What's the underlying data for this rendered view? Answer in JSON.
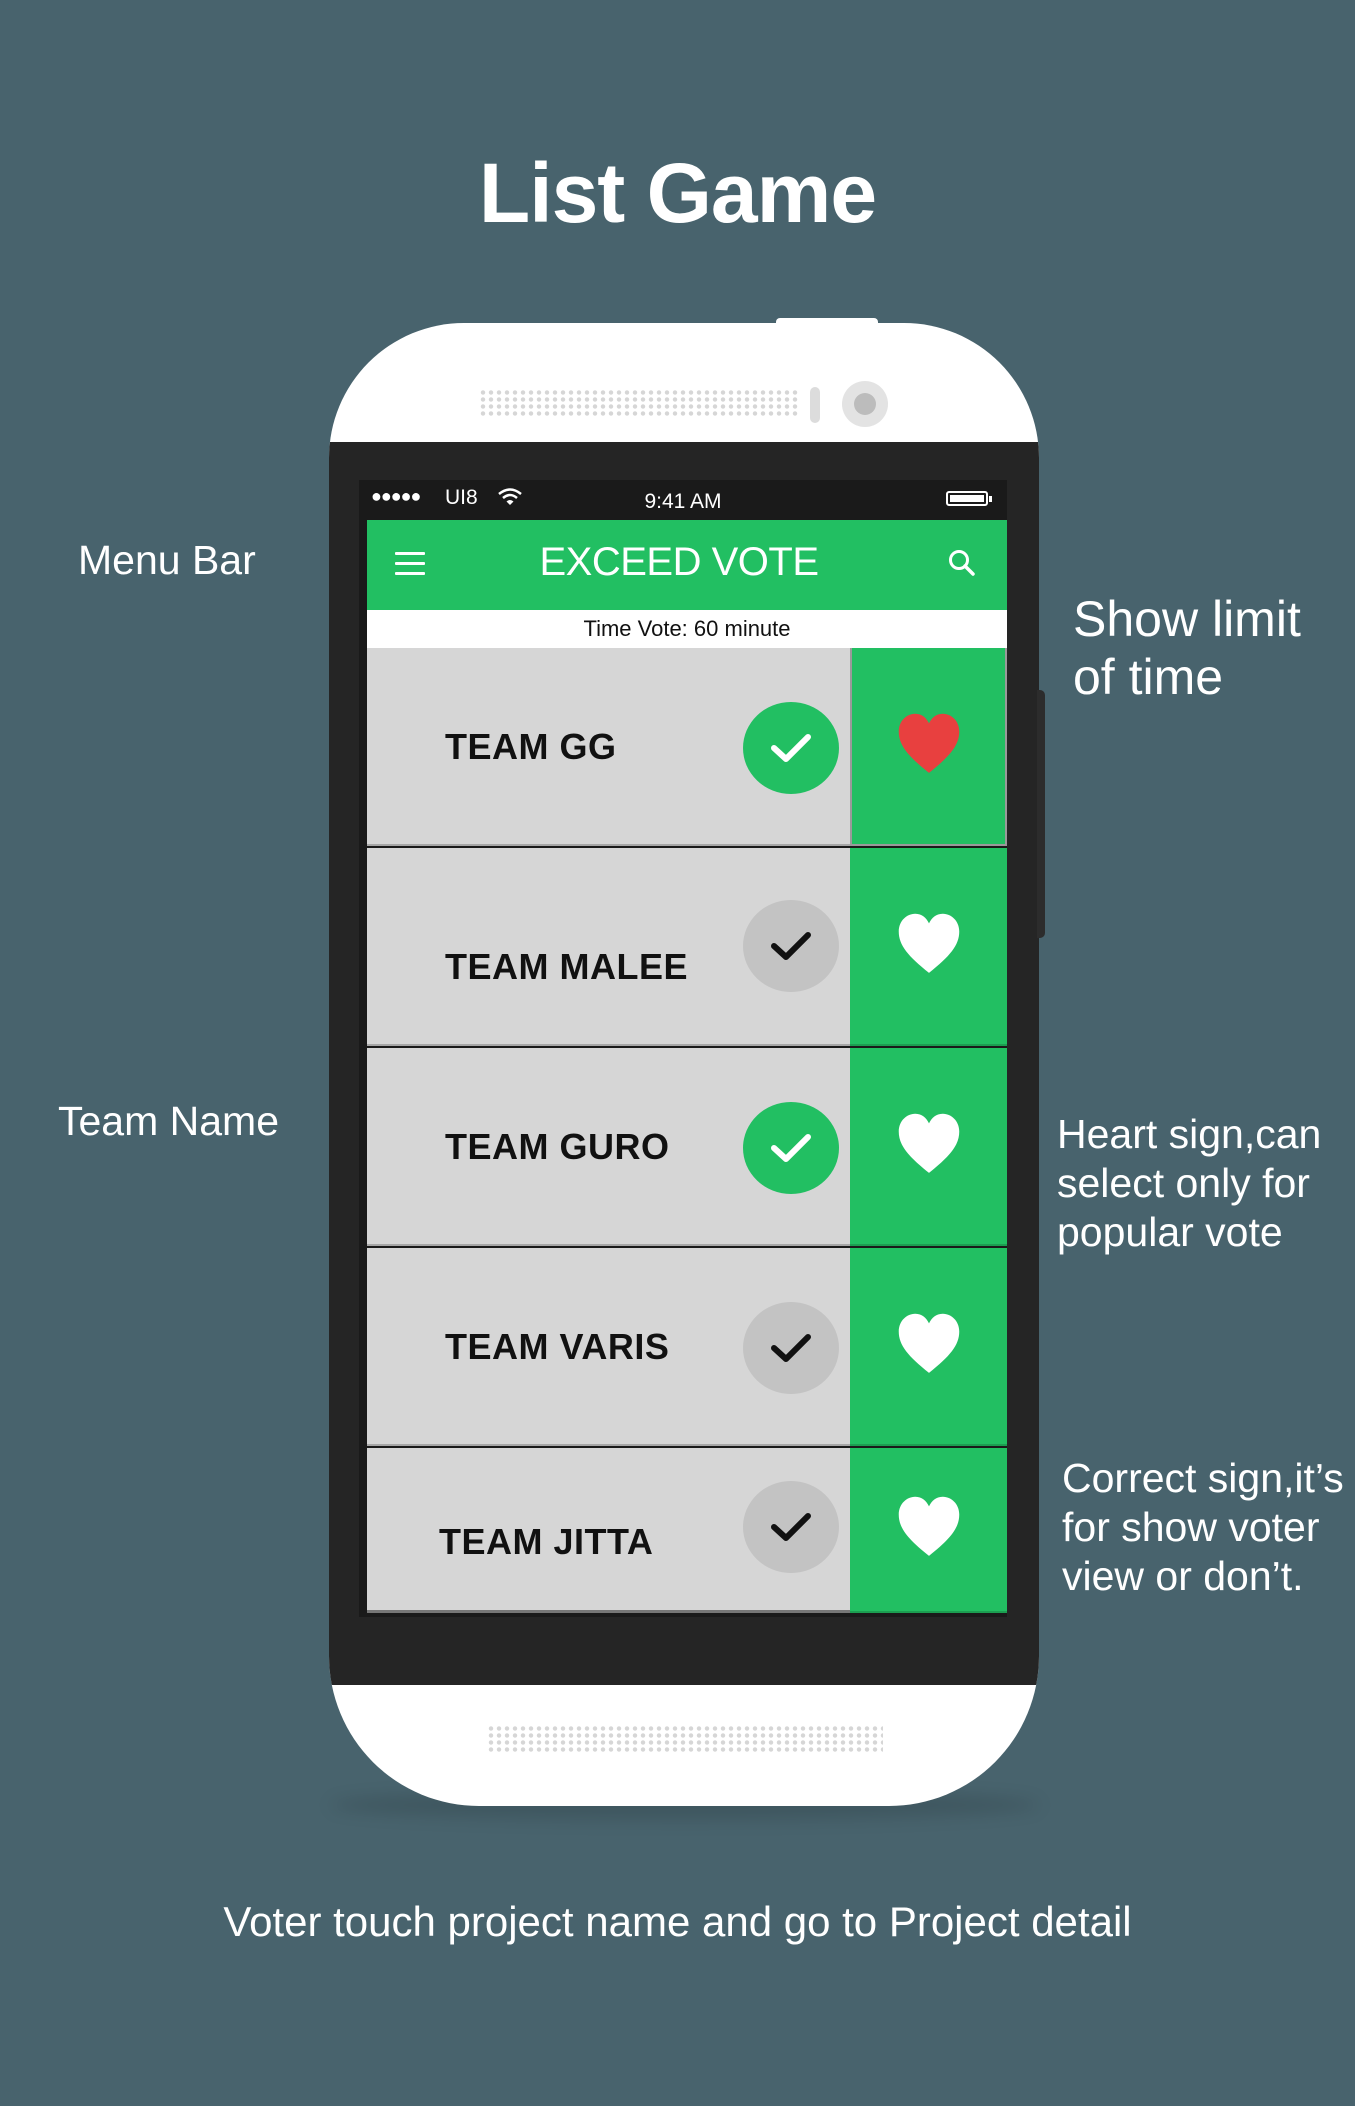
{
  "page": {
    "title": "List Game",
    "caption": "Voter touch project name and go to Project detail"
  },
  "annotations": {
    "menu_bar": "Menu Bar",
    "team_name": "Team Name",
    "time_limit": "Show limit\nof time",
    "heart": "Heart sign,can\nselect only for\npopular vote",
    "correct": "Correct sign,it’s\nfor show voter\nview or don’t."
  },
  "status_bar": {
    "signal": "●●●●●",
    "carrier": "UI8",
    "time": "9:41 AM"
  },
  "app": {
    "title": "EXCEED VOTE",
    "time_vote": "Time Vote: 60 minute"
  },
  "teams": [
    {
      "name": "TEAM GG",
      "checked": true,
      "liked": true
    },
    {
      "name": "TEAM MALEE",
      "checked": false,
      "liked": false
    },
    {
      "name": "TEAM GURO",
      "checked": true,
      "liked": false
    },
    {
      "name": "TEAM VARIS",
      "checked": false,
      "liked": false
    },
    {
      "name": "TEAM JITTA",
      "checked": false,
      "liked": false
    }
  ],
  "icons": {
    "menu": "menu-icon",
    "search": "search-icon",
    "check": "check-icon",
    "heart": "heart-icon",
    "wifi": "wifi-icon",
    "battery": "battery-icon"
  },
  "colors": {
    "background": "#48636d",
    "accent_green": "#22bf62",
    "heart_liked": "#e8403f",
    "row_gray": "#d6d6d6",
    "check_off": "#c3c3c3"
  }
}
